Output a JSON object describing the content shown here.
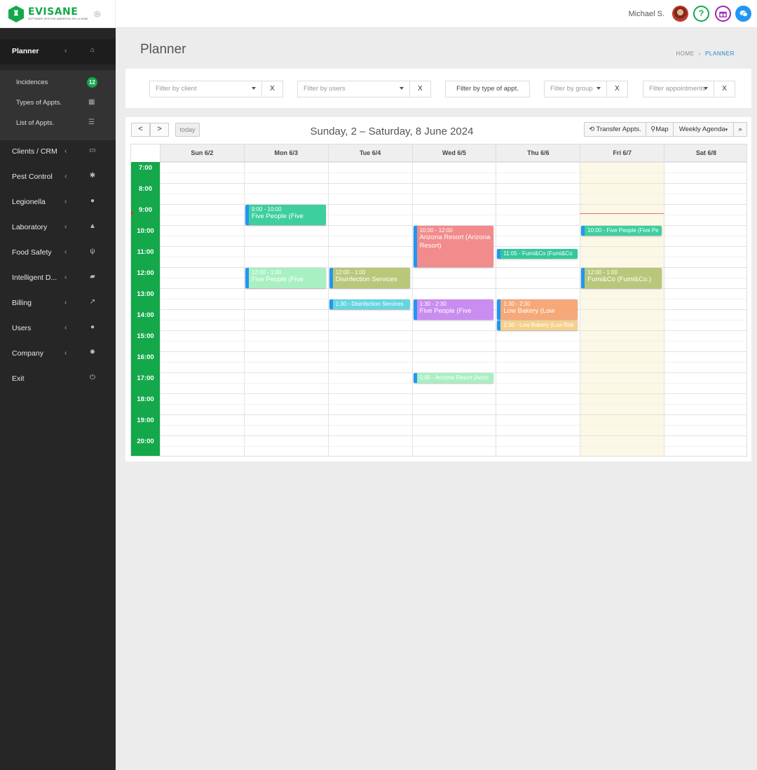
{
  "app": {
    "brand": "EVISANE",
    "tagline": "SOFTWARE GESTION AMBIENTAL EN LA NUBE",
    "user": "Michael S."
  },
  "icons": {
    "help": "?",
    "gift": "gift-icon",
    "chat": "chat-icon"
  },
  "sidebar": {
    "items": [
      {
        "label": "Planner",
        "icon": "home-icon"
      },
      {
        "label": "Clients / CRM",
        "icon": "id-card-icon"
      },
      {
        "label": "Pest Control",
        "icon": "bug-icon"
      },
      {
        "label": "Legionella",
        "icon": "drop-icon"
      },
      {
        "label": "Laboratory",
        "icon": "flask-icon"
      },
      {
        "label": "Food Safety",
        "icon": "cutlery-icon"
      },
      {
        "label": "Intelligent D...",
        "icon": "folder-icon"
      },
      {
        "label": "Billing",
        "icon": "chart-icon"
      },
      {
        "label": "Users",
        "icon": "user-icon"
      },
      {
        "label": "Company",
        "icon": "gear-icon"
      },
      {
        "label": "Exit",
        "icon": "power-icon"
      }
    ],
    "sub": [
      {
        "label": "Incidences",
        "badge": "12"
      },
      {
        "label": "Types of Appts.",
        "icon": "calendar-icon"
      },
      {
        "label": "List of Appts.",
        "icon": "list-icon"
      }
    ]
  },
  "page": {
    "title": "Planner",
    "breadcrumb": {
      "home": "HOME",
      "current": "PLANNER"
    }
  },
  "filters": {
    "client_placeholder": "Filter by client",
    "users_placeholder": "Filter by users",
    "type_label": "Filter by type of appt.",
    "group_placeholder": "Filter by group",
    "appointments_placeholder": "Filter appointments",
    "clear": "X"
  },
  "calendar": {
    "prev": "<",
    "next": ">",
    "today": "today",
    "title": "Sunday, 2 – Saturday, 8 June 2024",
    "transfer": "Transfer Appts.",
    "map": "Map",
    "view": "Weekly Agenda",
    "days": [
      "Sun 6/2",
      "Mon 6/3",
      "Tue 6/4",
      "Wed 6/5",
      "Thu 6/6",
      "Fri 6/7",
      "Sat 6/8"
    ],
    "today_index": 5,
    "hours": [
      "7:00",
      "8:00",
      "9:00",
      "10:00",
      "11:00",
      "12:00",
      "13:00",
      "14:00",
      "15:00",
      "16:00",
      "17:00",
      "18:00",
      "19:00",
      "20:00"
    ],
    "now": "9:30",
    "events": [
      {
        "day": 1,
        "start": "9:00",
        "end": "10:00",
        "time": "9:00 - 10:00",
        "title": "Five People (Five",
        "color": "#3ecf9e"
      },
      {
        "day": 1,
        "start": "12:00",
        "end": "13:00",
        "time": "12:00 - 1:00",
        "title": "Five People (Five",
        "color": "#a8f0c2"
      },
      {
        "day": 2,
        "start": "12:00",
        "end": "13:00",
        "time": "12:00 - 1:00",
        "title": "Disinfection Services",
        "color": "#b9c77a"
      },
      {
        "day": 2,
        "start": "13:30",
        "end": "14:00",
        "time": "1:30",
        "title": "Disinfection Services",
        "color": "#63d6e0",
        "mini": true
      },
      {
        "day": 3,
        "start": "10:00",
        "end": "12:00",
        "time": "10:00 - 12:00",
        "title": "Arizona Resort (Arizona Resort)",
        "color": "#f28b8b"
      },
      {
        "day": 3,
        "start": "13:30",
        "end": "14:30",
        "time": "1:30 - 2:30",
        "title": "Five People (Five",
        "color": "#c98cf0"
      },
      {
        "day": 3,
        "start": "17:00",
        "end": "17:30",
        "time": "5:00",
        "title": "Arizona Resort (Arizo",
        "color": "#a8f0c2",
        "mini": true
      },
      {
        "day": 4,
        "start": "11:05",
        "end": "11:35",
        "time": "11:05",
        "title": "Fumi&Co (Fumi&Co",
        "color": "#34c79a",
        "mini": true
      },
      {
        "day": 4,
        "start": "13:30",
        "end": "14:30",
        "time": "1:30 - 2:30",
        "title": "Low Bakery (Low",
        "color": "#f7a878"
      },
      {
        "day": 4,
        "start": "14:30",
        "end": "15:00",
        "time": "2:30",
        "title": "Low Bakery (Low Bak",
        "color": "#f6d08a",
        "mini": true
      },
      {
        "day": 5,
        "start": "10:00",
        "end": "10:30",
        "time": "10:00",
        "title": "Five People (Five Pe",
        "color": "#3ecf9e",
        "mini": true
      },
      {
        "day": 5,
        "start": "12:00",
        "end": "13:00",
        "time": "12:00 - 1:00",
        "title": "Fumi&Co (Fumi&Co.)",
        "color": "#b9c77a"
      }
    ]
  }
}
